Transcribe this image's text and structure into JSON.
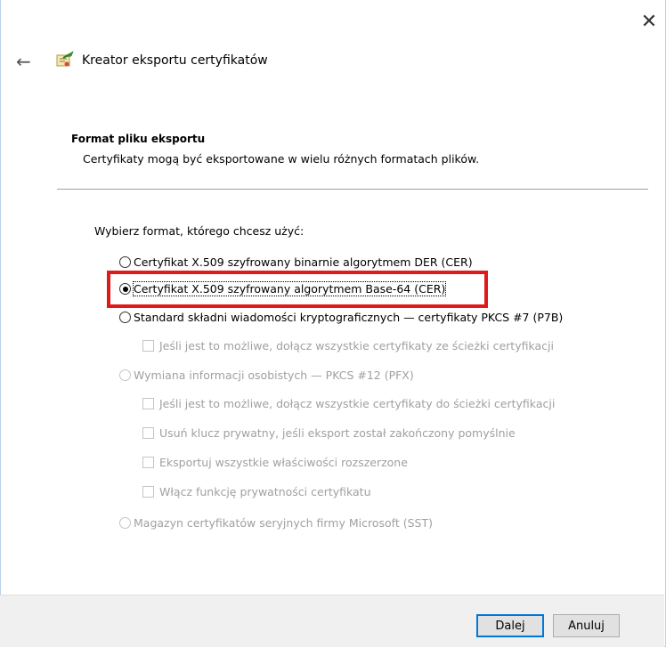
{
  "window": {
    "title": "Kreator eksportu certyfikatów",
    "close_glyph": "✕",
    "back_glyph": "←"
  },
  "section": {
    "title": "Format pliku eksportu",
    "description": "Certyfikaty mogą być eksportowane w wielu różnych formatach plików."
  },
  "prompt": "Wybierz format, którego chcesz użyć:",
  "options": {
    "der": {
      "label": "Certyfikat X.509 szyfrowany binarnie algorytmem DER (CER)",
      "checked": false,
      "enabled": true
    },
    "base64": {
      "label": "Certyfikat X.509 szyfrowany algorytmem Base-64 (CER)",
      "checked": true,
      "enabled": true
    },
    "pkcs7": {
      "label": "Standard składni wiadomości kryptograficznych — certyfikaty PKCS #7 (P7B)",
      "checked": false,
      "enabled": true
    },
    "pkcs7_include_all": {
      "label": "Jeśli jest to możliwe, dołącz wszystkie certyfikaty ze ścieżki certyfikacji",
      "checked": false,
      "enabled": false
    },
    "pfx": {
      "label": "Wymiana informacji osobistych — PKCS #12 (PFX)",
      "checked": false,
      "enabled": false
    },
    "pfx_include_all": {
      "label": "Jeśli jest to możliwe, dołącz wszystkie certyfikaty do ścieżki certyfikacji",
      "checked": false,
      "enabled": false
    },
    "pfx_delete_key": {
      "label": "Usuń klucz prywatny, jeśli eksport został zakończony pomyślnie",
      "checked": false,
      "enabled": false
    },
    "pfx_export_ext": {
      "label": "Eksportuj wszystkie właściwości rozszerzone",
      "checked": false,
      "enabled": false
    },
    "pfx_privacy": {
      "label": "Włącz funkcję prywatności certyfikatu",
      "checked": false,
      "enabled": false
    },
    "sst": {
      "label": "Magazyn certyfikatów seryjnych firmy Microsoft (SST)",
      "checked": false,
      "enabled": false
    }
  },
  "buttons": {
    "next": "Dalej",
    "cancel": "Anuluj"
  },
  "colors": {
    "highlight": "#e01a1a",
    "primary_border": "#0078d7",
    "disabled_text": "#a0a0a0"
  },
  "icons": {
    "wizard": "certificate-wizard-icon",
    "back": "back-arrow-icon",
    "close": "close-icon"
  }
}
